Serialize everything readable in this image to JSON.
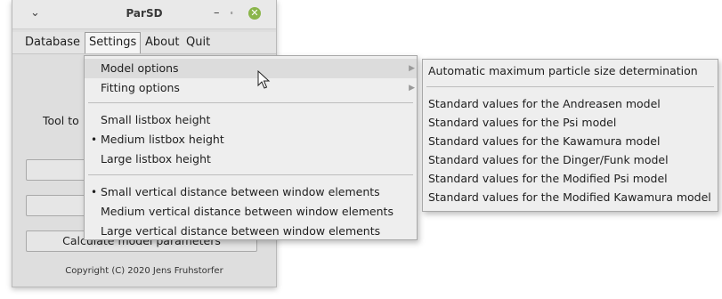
{
  "window": {
    "title": "ParSD",
    "controls": {
      "menu": "⌄",
      "minimize": "–",
      "maximize": "⬞",
      "close": "✕"
    }
  },
  "menubar": {
    "items": [
      {
        "label": "Database"
      },
      {
        "label": "Settings"
      },
      {
        "label": "About"
      },
      {
        "label": "Quit"
      }
    ]
  },
  "background": {
    "tool_text": "Tool to",
    "calc_button": "Calculate model parameters",
    "copyright": "Copyright (C) 2020 Jens Fruhstorfer"
  },
  "settings_menu": {
    "items": [
      {
        "label": "Model options",
        "submenu": true
      },
      {
        "label": "Fitting options",
        "submenu": true
      },
      {
        "label": "Small listbox height"
      },
      {
        "label": "Medium listbox height",
        "selected": true
      },
      {
        "label": "Large listbox height"
      },
      {
        "label": "Small vertical distance between window elements",
        "selected": true
      },
      {
        "label": "Medium vertical distance between window elements"
      },
      {
        "label": "Large vertical distance between window elements"
      }
    ],
    "arrow": "▶",
    "bullet": "•"
  },
  "model_submenu": {
    "items": [
      {
        "label": "Automatic maximum particle size determination"
      },
      {
        "label": "Standard values for the Andreasen model"
      },
      {
        "label": "Standard values for the Psi model"
      },
      {
        "label": "Standard values for the Kawamura model"
      },
      {
        "label": "Standard values for the Dinger/Funk model"
      },
      {
        "label": "Standard values for the Modified Psi model"
      },
      {
        "label": "Standard values for the Modified Kawamura model"
      }
    ]
  },
  "colors": {
    "close_button": "#8ab54a",
    "highlight": "#dcdcdc",
    "menu_bg": "#eeeeee"
  }
}
